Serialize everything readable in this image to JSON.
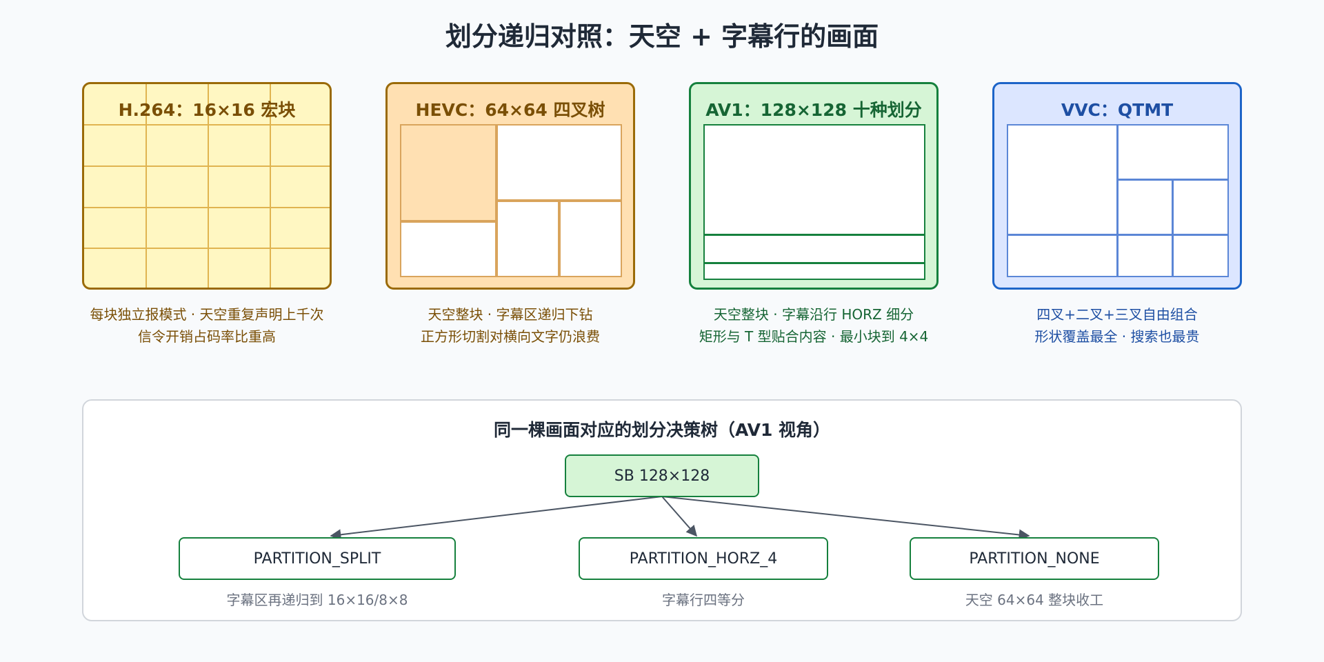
{
  "title": "划分递归对照：天空 + 字幕行的画面",
  "colors": {
    "h264": {
      "bg": "#fff7c2",
      "border": "#9a6a08",
      "line": "#e0b450",
      "text": "#7a4f06"
    },
    "hevc": {
      "bg": "#ffe0b2",
      "border": "#9a6a08",
      "line": "#d9a45c",
      "text": "#7a4f06"
    },
    "av1": {
      "bg": "#d6f5d6",
      "border": "#15803d",
      "line": "#15803d",
      "text": "#166534"
    },
    "vvc": {
      "bg": "#dce6ff",
      "border": "#1d64c8",
      "line": "#5b86d6",
      "text": "#1e4fa3"
    }
  },
  "cards": [
    {
      "key": "h264",
      "title": "H.264：16×16 宏块",
      "caption": [
        "每块独立报模式 · 天空重复声明上千次",
        "信令开销占码率比重高"
      ]
    },
    {
      "key": "hevc",
      "title": "HEVC：64×64 四叉树",
      "caption": [
        "天空整块 · 字幕区递归下钻",
        "正方形切割对横向文字仍浪费"
      ]
    },
    {
      "key": "av1",
      "title": "AV1：128×128 十种划分",
      "caption": [
        "天空整块 · 字幕沿行 HORZ 细分",
        "矩形与 T 型贴合内容 · 最小块到 4×4"
      ]
    },
    {
      "key": "vvc",
      "title": "VVC：QTMT",
      "caption": [
        "四叉+二叉+三叉自由组合",
        "形状覆盖最全 · 搜索也最贵"
      ]
    }
  ],
  "tree": {
    "title": "同一棵画面对应的划分决策树（AV1 视角）",
    "root": "SB 128×128",
    "children": [
      {
        "label": "PARTITION_SPLIT",
        "note": "字幕区再递归到 16×16/8×8"
      },
      {
        "label": "PARTITION_HORZ_4",
        "note": "字幕行四等分"
      },
      {
        "label": "PARTITION_NONE",
        "note": "天空 64×64 整块收工"
      }
    ]
  }
}
